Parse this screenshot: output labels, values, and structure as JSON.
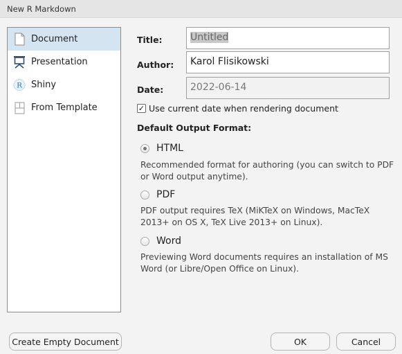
{
  "window": {
    "title": "New R Markdown"
  },
  "sidebar": {
    "items": [
      {
        "label": "Document",
        "icon": "document-icon",
        "selected": true
      },
      {
        "label": "Presentation",
        "icon": "presentation-icon",
        "selected": false
      },
      {
        "label": "Shiny",
        "icon": "shiny-r-icon",
        "selected": false
      },
      {
        "label": "From Template",
        "icon": "template-icon",
        "selected": false
      }
    ]
  },
  "form": {
    "title_label": "Title:",
    "title_value": "Untitled",
    "author_label": "Author:",
    "author_value": "Karol Flisikowski",
    "date_label": "Date:",
    "date_value": "2022-06-14",
    "use_current_date_label": "Use current date when rendering document",
    "use_current_date_checked": true,
    "output_format_heading": "Default Output Format:",
    "formats": [
      {
        "label": "HTML",
        "selected": true,
        "description": "Recommended format for authoring (you can switch to PDF or Word output anytime)."
      },
      {
        "label": "PDF",
        "selected": false,
        "description": "PDF output requires TeX (MiKTeX on Windows, MacTeX 2013+ on OS X, TeX Live 2013+ on Linux)."
      },
      {
        "label": "Word",
        "selected": false,
        "description": "Previewing Word documents requires an installation of MS Word (or Libre/Open Office on Linux)."
      }
    ]
  },
  "buttons": {
    "create_empty": "Create Empty Document",
    "ok": "OK",
    "cancel": "Cancel"
  },
  "check_glyph": "✓"
}
